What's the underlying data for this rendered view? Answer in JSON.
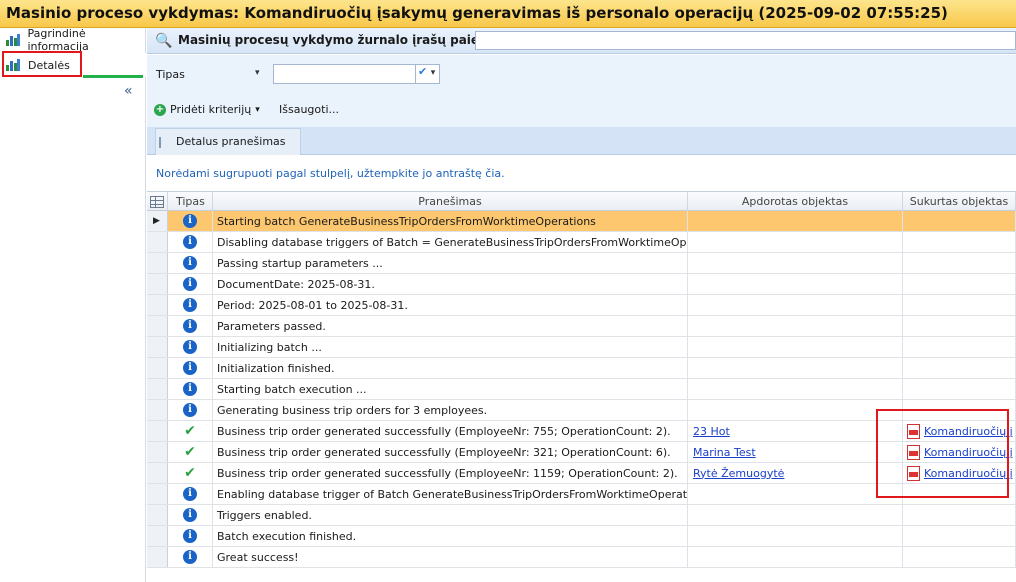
{
  "window": {
    "title": "Masinio proceso vykdymas: Komandiruočių įsakymų generavimas iš personalo operacijų (2025-09-02 07:55:25)"
  },
  "sidebar": {
    "items": [
      {
        "label": "Pagrindinė informacija",
        "icon": "chart-icon"
      },
      {
        "label": "Detalės",
        "icon": "chart-icon"
      }
    ],
    "collapse_label": "«"
  },
  "header": {
    "title": "Masinių procesų vykdymo žurnalo įrašų paieška",
    "search_value": ""
  },
  "filter": {
    "label": "Tipas",
    "value": ""
  },
  "toolbar": {
    "add_criteria_label": "Pridėti kriterijų",
    "save_label": "Išsaugoti..."
  },
  "tabs": [
    {
      "label": "Detalus pranešimas"
    }
  ],
  "group_hint": "Norėdami sugrupuoti pagal stulpelį, užtempkite jo antraštę čia.",
  "grid": {
    "columns": [
      "Tipas",
      "Pranešimas",
      "Apdorotas objektas",
      "Sukurtas objektas"
    ],
    "rows": [
      {
        "type": "info",
        "message": "Starting batch GenerateBusinessTripOrdersFromWorktimeOperations",
        "processed": "",
        "created": ""
      },
      {
        "type": "info",
        "message": "Disabling database triggers of Batch = GenerateBusinessTripOrdersFromWorktimeOperations",
        "processed": "",
        "created": ""
      },
      {
        "type": "info",
        "message": "Passing startup parameters ...",
        "processed": "",
        "created": ""
      },
      {
        "type": "info",
        "message": "DocumentDate: 2025-08-31.",
        "processed": "",
        "created": ""
      },
      {
        "type": "info",
        "message": "Period: 2025-08-01 to 2025-08-31.",
        "processed": "",
        "created": ""
      },
      {
        "type": "info",
        "message": "Parameters passed.",
        "processed": "",
        "created": ""
      },
      {
        "type": "info",
        "message": "Initializing batch ...",
        "processed": "",
        "created": ""
      },
      {
        "type": "info",
        "message": "Initialization finished.",
        "processed": "",
        "created": ""
      },
      {
        "type": "info",
        "message": "Starting batch execution ...",
        "processed": "",
        "created": ""
      },
      {
        "type": "info",
        "message": "Generating business trip orders for 3 employees.",
        "processed": "",
        "created": ""
      },
      {
        "type": "success",
        "message": "Business trip order generated successfully (EmployeeNr: 755; OperationCount: 2).",
        "processed": "23 Hot",
        "created": "Komandiruočių į"
      },
      {
        "type": "success",
        "message": "Business trip order generated successfully (EmployeeNr: 321; OperationCount: 6).",
        "processed": "Marina Test",
        "created": "Komandiruočių į"
      },
      {
        "type": "success",
        "message": "Business trip order generated successfully (EmployeeNr: 1159; OperationCount: 2).",
        "processed": "Rytė Žemuogytė",
        "created": "Komandiruočių į"
      },
      {
        "type": "info",
        "message": "Enabling database trigger of Batch GenerateBusinessTripOrdersFromWorktimeOperations",
        "processed": "",
        "created": ""
      },
      {
        "type": "info",
        "message": "Triggers enabled.",
        "processed": "",
        "created": ""
      },
      {
        "type": "info",
        "message": "Batch execution finished.",
        "processed": "",
        "created": ""
      },
      {
        "type": "info",
        "message": "Great success!",
        "processed": "",
        "created": ""
      }
    ]
  },
  "colors": {
    "title_bar": "#f8c84a",
    "active_row": "#fcc76f",
    "highlight_box": "#e0181b",
    "link": "#1a3fc9"
  }
}
